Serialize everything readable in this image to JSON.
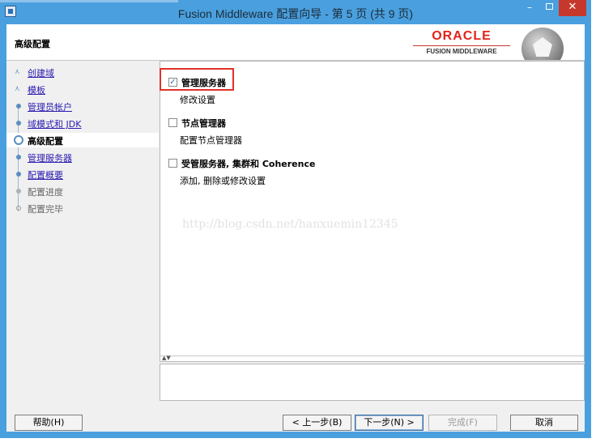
{
  "window": {
    "title": "Fusion Middleware 配置向导 - 第 5 页 (共 9 页)",
    "minimize": "–",
    "close": "✕"
  },
  "header": {
    "page_title": "高级配置",
    "brand": "ORACLE",
    "brand_sub": "FUSION MIDDLEWARE"
  },
  "nav": {
    "items": [
      {
        "label": "创建域",
        "state": "done"
      },
      {
        "label": "模板",
        "state": "done"
      },
      {
        "label": "管理员帐户",
        "state": "done"
      },
      {
        "label": "域模式和 JDK",
        "state": "done"
      },
      {
        "label": "高级配置",
        "state": "current"
      },
      {
        "label": "管理服务器",
        "state": "done"
      },
      {
        "label": "配置概要",
        "state": "done"
      },
      {
        "label": "配置进度",
        "state": "pending"
      },
      {
        "label": "配置完毕",
        "state": "pending"
      }
    ]
  },
  "options": [
    {
      "title": "管理服务器",
      "desc": "修改设置",
      "checked": true
    },
    {
      "title": "节点管理器",
      "desc": "配置节点管理器",
      "checked": false
    },
    {
      "title": "受管服务器, 集群和 Coherence",
      "desc": "添加, 删除或修改设置",
      "checked": false
    }
  ],
  "watermark": "http://blog.csdn.net/hanxuemin12345",
  "buttons": {
    "help": "帮助(H)",
    "back": "< 上一步(B)",
    "next": "下一步(N) >",
    "finish": "完成(F)",
    "cancel": "取消"
  },
  "colors": {
    "titlebar": "#4aa0de",
    "close_button": "#c7382c",
    "highlight_box": "#e03227",
    "link": "#2a1ab0",
    "oracle_red": "#e0241b"
  }
}
